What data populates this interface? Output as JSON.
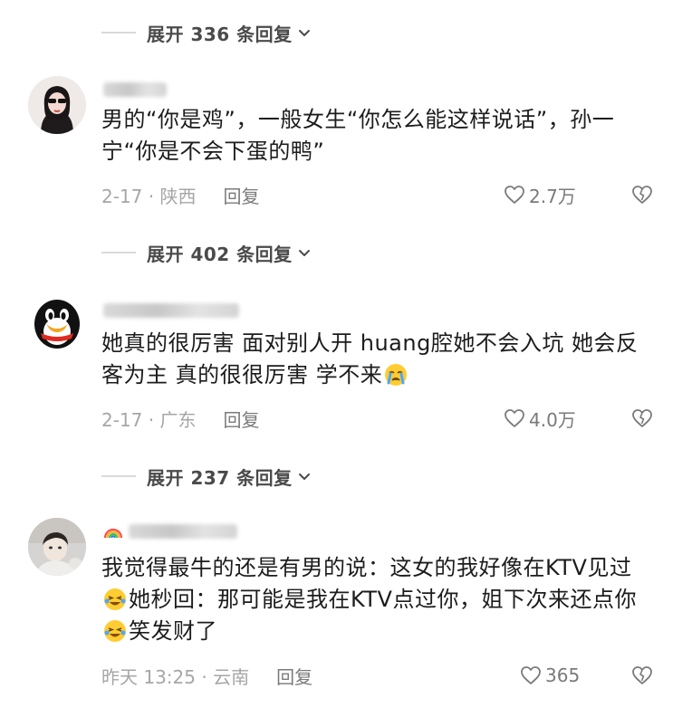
{
  "colors": {
    "text_primary": "#1c1c1c",
    "text_secondary": "#a6a6a6",
    "expand_text": "#4a4a4a",
    "divider": "#d9d9d9"
  },
  "expand_rows": [
    {
      "label": "展开 336 条回复"
    },
    {
      "label": "展开 402 条回复"
    },
    {
      "label": "展开 237 条回复"
    }
  ],
  "comments": [
    {
      "avatar_icon": "avatar-girl-sunglasses",
      "text": "男的“你是鸡”，一般女生“你怎么能这样说话”，孙一宁“你是不会下蛋的鸭”",
      "date_location": "2-17 · 陕西",
      "reply_label": "回复",
      "likes": "2.7万"
    },
    {
      "avatar_icon": "avatar-qq-penguin",
      "text_part1": "她真的很厉害 面对别人开 huang腔她不会入坑 她会反客为主 真的很很厉害 学不来",
      "emoji1": "crying-face-emoji",
      "date_location": "2-17 · 广东",
      "reply_label": "回复",
      "likes": "4.0万"
    },
    {
      "avatar_icon": "avatar-person-photo",
      "text_part1": "我觉得最牛的还是有男的说：这女的我好像在KTV见过",
      "emoji1": "laughing-crying-emoji",
      "text_part2": "她秒回：那可能是我在KTV点过你，姐下次来还点你",
      "emoji2": "laughing-crying-emoji",
      "text_part3": "笑发财了",
      "date_location": "昨天 13:25 · 云南",
      "reply_label": "回复",
      "likes": "365"
    }
  ]
}
